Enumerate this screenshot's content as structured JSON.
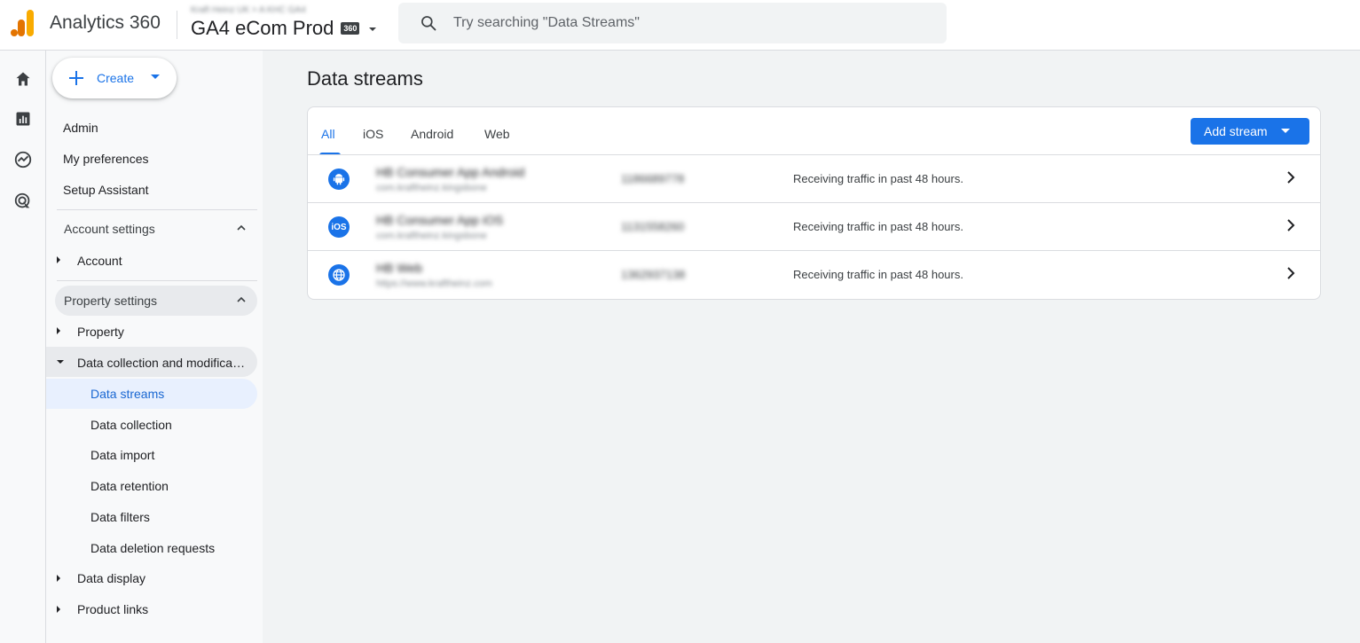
{
  "header": {
    "product_name": "Analytics 360",
    "account_path": "Kraft Heinz UK > A KHC GA4",
    "property_name": "GA4 eCom Prod",
    "property_badge": "360",
    "search_placeholder": "Try searching \"Data Streams\""
  },
  "rail": {
    "items": [
      {
        "icon": "home-icon"
      },
      {
        "icon": "reports-icon"
      },
      {
        "icon": "explore-icon"
      },
      {
        "icon": "advertising-icon"
      }
    ]
  },
  "sidenav": {
    "create_label": "Create",
    "items": {
      "admin": "Admin",
      "my_preferences": "My preferences",
      "setup_assistant": "Setup Assistant"
    },
    "account_settings": {
      "label": "Account settings",
      "account": "Account"
    },
    "property_settings": {
      "label": "Property settings",
      "property": "Property",
      "data_collection_mod": "Data collection and modifica…",
      "data_streams": "Data streams",
      "data_collection": "Data collection",
      "data_import": "Data import",
      "data_retention": "Data retention",
      "data_filters": "Data filters",
      "data_deletion_requests": "Data deletion requests",
      "data_display": "Data display",
      "product_links": "Product links"
    }
  },
  "main": {
    "title": "Data streams",
    "tabs": [
      {
        "label": "All",
        "active": true
      },
      {
        "label": "iOS",
        "active": false
      },
      {
        "label": "Android",
        "active": false
      },
      {
        "label": "Web",
        "active": false
      }
    ],
    "add_stream_label": "Add stream",
    "streams": [
      {
        "icon": "android-icon",
        "name": "HB Consumer App Android",
        "sub": "com.kraftheinz.kingsbone",
        "id": "1186689778",
        "status": "Receiving traffic in past 48 hours."
      },
      {
        "icon": "ios-icon",
        "name": "HB Consumer App iOS",
        "sub": "com.kraftheinz.kingsbone",
        "id": "1131558260",
        "status": "Receiving traffic in past 48 hours."
      },
      {
        "icon": "globe-icon",
        "name": "HB Web",
        "sub": "https://www.kraftheinz.com",
        "id": "1362937138",
        "status": "Receiving traffic in past 48 hours."
      }
    ],
    "ios_glyph": "iOS"
  },
  "colors": {
    "accent": "#1a73e8",
    "selected_bg": "#e8f0fe"
  }
}
